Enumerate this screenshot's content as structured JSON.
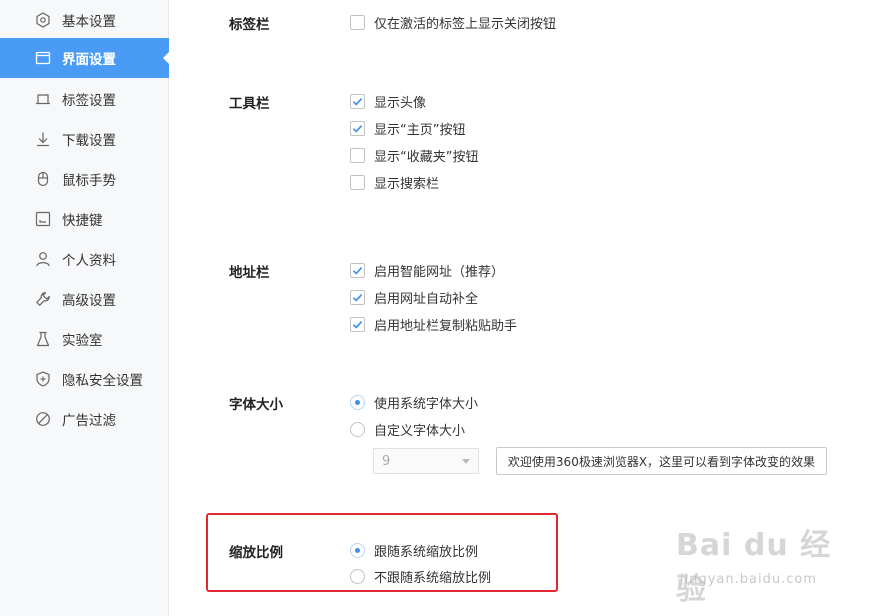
{
  "sidebar": {
    "items": [
      {
        "label": "基本设置",
        "icon": "gear-icon"
      },
      {
        "label": "界面设置",
        "icon": "window-icon"
      },
      {
        "label": "标签设置",
        "icon": "tab-icon"
      },
      {
        "label": "下载设置",
        "icon": "download-icon"
      },
      {
        "label": "鼠标手势",
        "icon": "mouse-icon"
      },
      {
        "label": "快捷键",
        "icon": "shortcut-icon"
      },
      {
        "label": "个人资料",
        "icon": "user-icon"
      },
      {
        "label": "高级设置",
        "icon": "wrench-icon"
      },
      {
        "label": "实验室",
        "icon": "flask-icon"
      },
      {
        "label": "隐私安全设置",
        "icon": "shield-icon"
      },
      {
        "label": "广告过滤",
        "icon": "block-icon"
      }
    ],
    "active_index": 1,
    "active_color": "#4a9bf5"
  },
  "tabbar": {
    "label": "标签栏",
    "options": [
      {
        "label": "仅在激活的标签上显示关闭按钮",
        "checked": false
      }
    ]
  },
  "toolbar": {
    "label": "工具栏",
    "options": [
      {
        "label": "显示头像",
        "checked": true
      },
      {
        "label": "显示“主页”按钮",
        "checked": true
      },
      {
        "label": "显示“收藏夹”按钮",
        "checked": false
      },
      {
        "label": "显示搜索栏",
        "checked": false
      }
    ]
  },
  "addressbar": {
    "label": "地址栏",
    "options": [
      {
        "label": "启用智能网址（推荐）",
        "checked": true
      },
      {
        "label": "启用网址自动补全",
        "checked": true
      },
      {
        "label": "启用地址栏复制粘贴助手",
        "checked": true
      }
    ]
  },
  "fontsize": {
    "label": "字体大小",
    "options": [
      {
        "label": "使用系统字体大小",
        "selected": true
      },
      {
        "label": "自定义字体大小",
        "selected": false
      }
    ],
    "select_value": "9",
    "preview_text": "欢迎使用360极速浏览器X，这里可以看到字体改变的效果"
  },
  "zoom": {
    "label": "缩放比例",
    "options": [
      {
        "label": "跟随系统缩放比例",
        "selected": true
      },
      {
        "label": "不跟随系统缩放比例",
        "selected": false
      }
    ]
  },
  "watermark": {
    "main": "Bai du 经验",
    "sub": "jingyan.baidu.com"
  },
  "colors": {
    "accent": "#4a9bf5",
    "check": "#3d8fe8",
    "highlight_box": "#e0282e"
  }
}
